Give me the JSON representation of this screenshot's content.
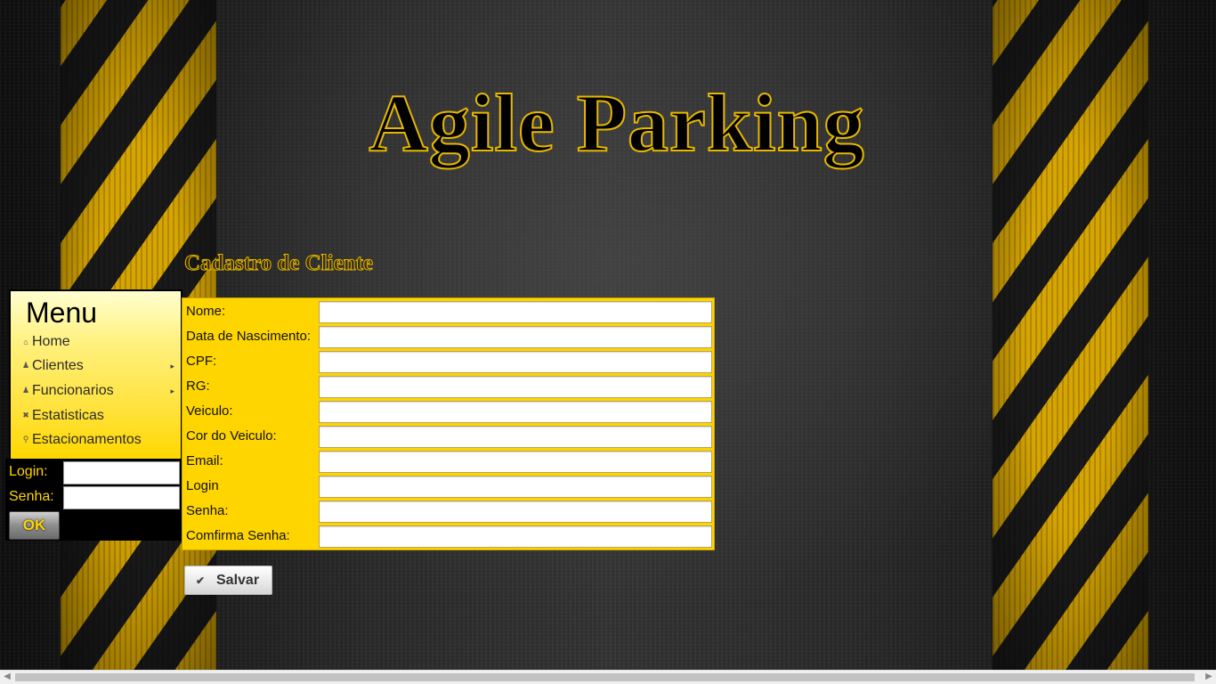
{
  "app": {
    "title": "Agile Parking"
  },
  "page": {
    "heading": "Cadastro de Cliente"
  },
  "menu": {
    "title": "Menu",
    "items": [
      {
        "label": "Home",
        "icon": "home-icon",
        "has_submenu": false
      },
      {
        "label": "Clientes",
        "icon": "person-icon",
        "has_submenu": true
      },
      {
        "label": "Funcionarios",
        "icon": "person-icon",
        "has_submenu": true
      },
      {
        "label": "Estatisticas",
        "icon": "close-icon",
        "has_submenu": false
      },
      {
        "label": "Estacionamentos",
        "icon": "search-icon",
        "has_submenu": false
      }
    ]
  },
  "login": {
    "login_label": "Login:",
    "password_label": "Senha:",
    "login_value": "",
    "password_value": "",
    "ok_label": "OK"
  },
  "form": {
    "fields": [
      {
        "label": "Nome:",
        "value": ""
      },
      {
        "label": "Data de Nascimento:",
        "value": ""
      },
      {
        "label": "CPF:",
        "value": ""
      },
      {
        "label": "RG:",
        "value": ""
      },
      {
        "label": "Veiculo:",
        "value": ""
      },
      {
        "label": "Cor do Veiculo:",
        "value": ""
      },
      {
        "label": "Email:",
        "value": ""
      },
      {
        "label": "Login",
        "value": ""
      },
      {
        "label": "Senha:",
        "value": ""
      },
      {
        "label": "Comfirma Senha:",
        "value": ""
      }
    ],
    "save_label": "Salvar"
  },
  "colors": {
    "accent_yellow": "#ffd500",
    "title_outline": "#e6b800",
    "background_dark": "#2a2a2a"
  }
}
